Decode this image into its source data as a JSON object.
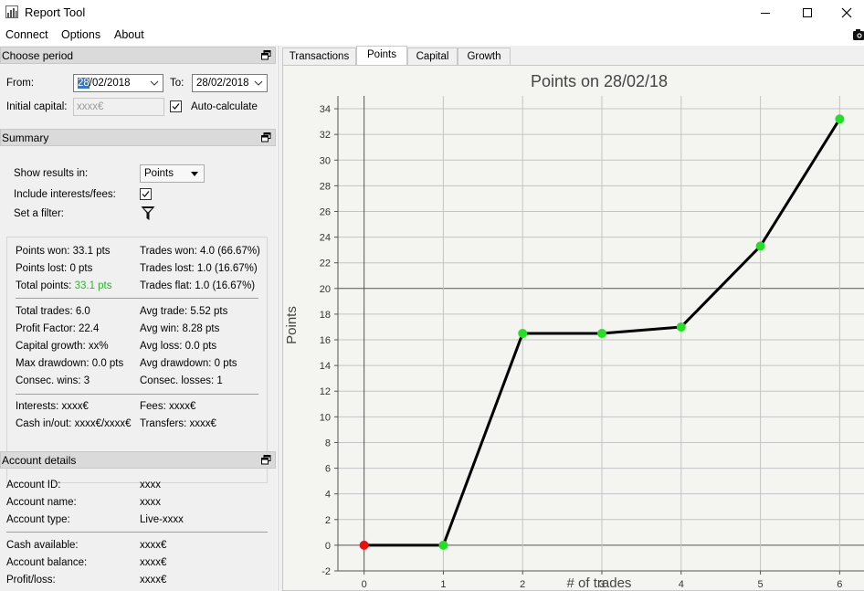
{
  "window": {
    "title": "Report Tool"
  },
  "menu": [
    "Connect",
    "Options",
    "About"
  ],
  "period": {
    "header": "Choose period",
    "from_label": "From:",
    "from_day": "28",
    "from_rest": "/02/2018",
    "to_label": "To:",
    "to_value": "28/02/2018",
    "capital_label": "Initial capital:",
    "capital_placeholder": "xxxx€",
    "auto_label": "Auto-calculate"
  },
  "summary": {
    "header": "Summary",
    "show_results_label": "Show results in:",
    "show_results_value": "Points",
    "include_fees_label": "Include interests/fees:",
    "filter_label": "Set a filter:",
    "points_won": "Points won: 33.1 pts",
    "trades_won": "Trades won: 4.0 (66.67%)",
    "points_lost": "Points lost: 0 pts",
    "trades_lost": "Trades lost: 1.0 (16.67%)",
    "total_points_label": "Total points:",
    "total_points_value": "33.1 pts",
    "trades_flat": "Trades flat: 1.0 (16.67%)",
    "total_trades": "Total trades: 6.0",
    "avg_trade": "Avg trade: 5.52 pts",
    "profit_factor": "Profit Factor: 22.4",
    "avg_win": "Avg win: 8.28 pts",
    "capital_growth": "Capital growth: xx%",
    "avg_loss": "Avg loss: 0.0 pts",
    "max_drawdown": "Max drawdown: 0.0 pts",
    "avg_drawdown": "Avg drawdown: 0 pts",
    "consec_wins": "Consec. wins: 3",
    "consec_losses": "Consec. losses: 1",
    "interests": "Interests: xxxx€",
    "fees": "Fees: xxxx€",
    "cash_in_out": "Cash in/out: xxxx€/xxxx€",
    "transfers": "Transfers: xxxx€",
    "positive_color": "#2ab52a"
  },
  "account": {
    "header": "Account details",
    "rows": [
      {
        "label": "Account ID:",
        "value": "xxxx"
      },
      {
        "label": "Account name:",
        "value": "xxxx"
      },
      {
        "label": "Account type:",
        "value": "Live-xxxx"
      },
      {
        "label": "Cash available:",
        "value": "xxxx€"
      },
      {
        "label": "Account balance:",
        "value": "xxxx€"
      },
      {
        "label": "Profit/loss:",
        "value": "xxxx€"
      }
    ]
  },
  "tabs": [
    "Transactions",
    "Points",
    "Capital",
    "Growth"
  ],
  "active_tab": "Points",
  "chart_data": {
    "type": "line",
    "title": "Points on 28/02/18",
    "xlabel": "# of trades",
    "ylabel": "Points",
    "x": [
      0,
      1,
      2,
      3,
      4,
      5,
      6
    ],
    "y": [
      0,
      0,
      16.5,
      16.5,
      17.0,
      23.3,
      33.2
    ],
    "marker_colors": [
      "#e81010",
      "#22e022",
      "#22e022",
      "#22e022",
      "#22e022",
      "#22e022",
      "#22e022"
    ],
    "xlim": [
      -0.33,
      6.33
    ],
    "ylim": [
      -2,
      35
    ],
    "xticks": [
      0,
      1,
      2,
      3,
      4,
      5,
      6
    ],
    "yticks": [
      -2,
      0,
      2,
      4,
      6,
      8,
      10,
      12,
      14,
      16,
      18,
      20,
      22,
      24,
      26,
      28,
      30,
      32,
      34
    ],
    "grid": true,
    "line_color": "#000000"
  }
}
